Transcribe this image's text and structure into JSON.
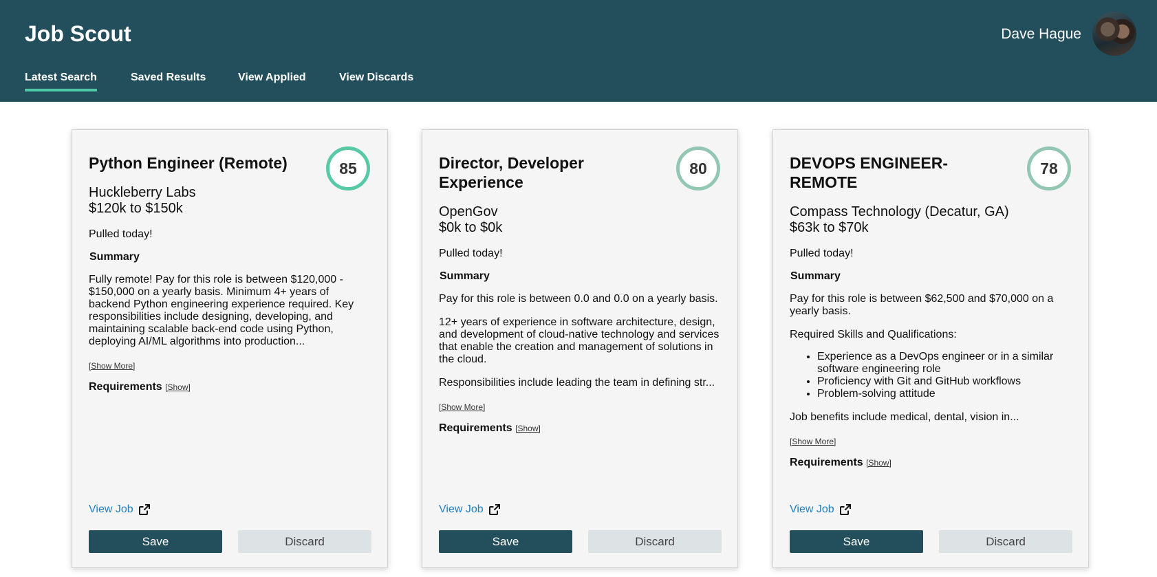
{
  "header": {
    "app_title": "Job Scout",
    "user_name": "Dave Hague",
    "colors": {
      "bar": "#234e5c",
      "active_tab_underline": "#4fc9a7"
    }
  },
  "nav": {
    "tabs": [
      {
        "label": "Latest Search",
        "active": true
      },
      {
        "label": "Saved Results",
        "active": false
      },
      {
        "label": "View Applied",
        "active": false
      },
      {
        "label": "View Discards",
        "active": false
      }
    ]
  },
  "cards": [
    {
      "title": "Python Engineer (Remote)",
      "score": "85",
      "company": "Huckleberry Labs",
      "salary": "$120k to $150k",
      "pulled": "Pulled today!",
      "summary_label": "Summary",
      "paragraphs": [
        "Fully remote! Pay for this role is between $120,000 - $150,000 on a yearly basis. Minimum 4+ years of backend Python engineering experience required. Key responsibilities include designing, developing, and maintaining scalable back-end code using Python, deploying AI/ML algorithms into production..."
      ],
      "show_more": "[Show More]",
      "requirements_label": "Requirements",
      "requirements_show": "[Show]",
      "view_job": "View Job",
      "save": "Save",
      "discard": "Discard"
    },
    {
      "title": "Director, Developer Experience",
      "score": "80",
      "company": "OpenGov",
      "salary": "$0k to $0k",
      "pulled": "Pulled today!",
      "summary_label": "Summary",
      "paragraphs": [
        "Pay for this role is between 0.0 and 0.0 on a yearly basis.",
        "12+ years of experience in software architecture, design, and development of cloud-native technology and services that enable the creation and management of solutions in the cloud.",
        "Responsibilities include leading the team in defining str..."
      ],
      "show_more": "[Show More]",
      "requirements_label": "Requirements",
      "requirements_show": "[Show]",
      "view_job": "View Job",
      "save": "Save",
      "discard": "Discard"
    },
    {
      "title": "DEVOPS ENGINEER- REMOTE",
      "score": "78",
      "company": "Compass Technology (Decatur, GA)",
      "salary": "$63k to $70k",
      "pulled": "Pulled today!",
      "summary_label": "Summary",
      "paragraphs": [
        "Pay for this role is between $62,500 and $70,000 on a yearly basis.",
        "Required Skills and Qualifications:"
      ],
      "bullets": [
        "Experience as a DevOps engineer or in a similar software engineering role",
        "Proficiency with Git and GitHub workflows",
        "Problem-solving attitude"
      ],
      "after_bullets": "Job benefits include medical, dental, vision in...",
      "show_more": "[Show More]",
      "requirements_label": "Requirements",
      "requirements_show": "[Show]",
      "view_job": "View Job",
      "save": "Save",
      "discard": "Discard"
    }
  ],
  "icons": {
    "external_link": "external-link-icon",
    "avatar": "user-avatar"
  }
}
